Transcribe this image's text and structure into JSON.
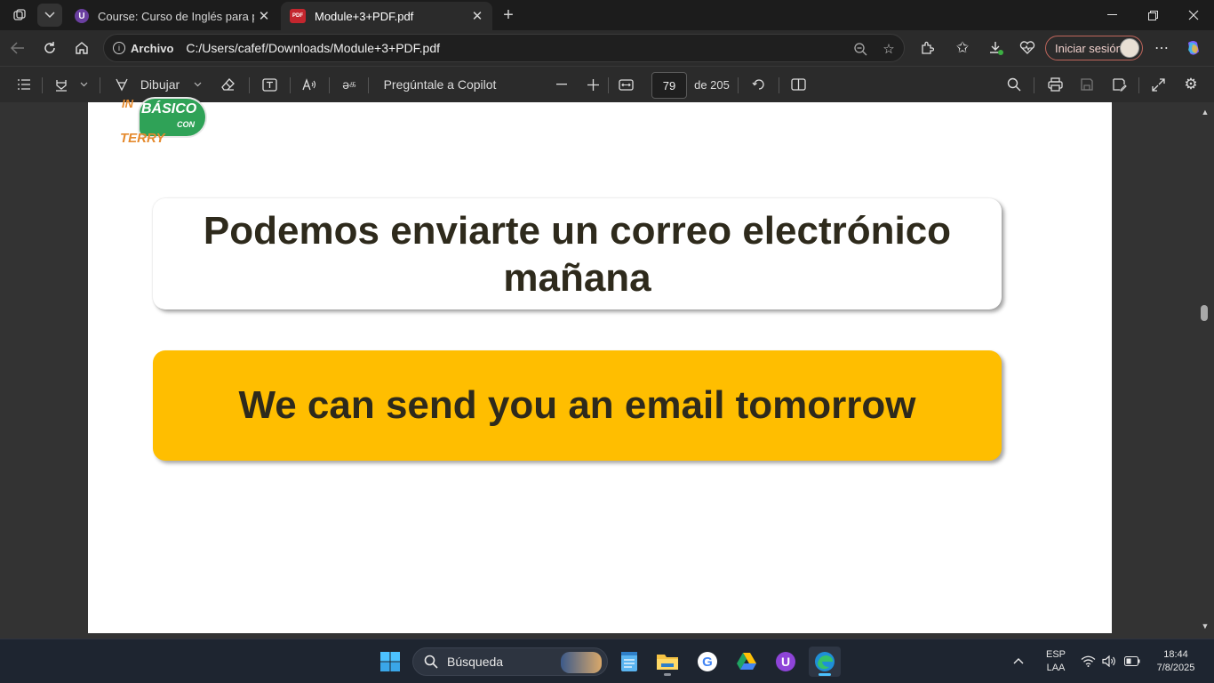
{
  "browser": {
    "tabs": [
      {
        "title": "Course: Curso de Inglés para principiantes",
        "favicon": "U",
        "active": false
      },
      {
        "title": "Module+3+PDF.pdf",
        "favicon": "PDF",
        "active": true
      }
    ],
    "new_tab_icon": "+",
    "address": {
      "label": "Archivo",
      "url": "C:/Users/cafef/Downloads/Module+3+PDF.pdf"
    },
    "signin_label": "Iniciar sesión"
  },
  "pdf_toolbar": {
    "draw_label": "Dibujar",
    "copilot_label": "Pregúntale a Copilot",
    "page_current": "79",
    "page_total_label": "de 205"
  },
  "page": {
    "logo": {
      "top": "INGLES",
      "main": "BÁSICO",
      "con": "CON",
      "bottom": "TERRY"
    },
    "spanish_sentence": "Podemos enviarte un correo electrónico mañana",
    "english_sentence": "We can send you an email tomorrow",
    "colors": {
      "english_card": "#ffbe00",
      "text": "#2e2a1c",
      "logo_green": "#2fa257",
      "logo_orange": "#e58a2e"
    }
  },
  "taskbar": {
    "search_placeholder": "Búsqueda",
    "language": "ESP",
    "layout": "LAA",
    "time": "18:44",
    "date": "7/8/2025"
  }
}
